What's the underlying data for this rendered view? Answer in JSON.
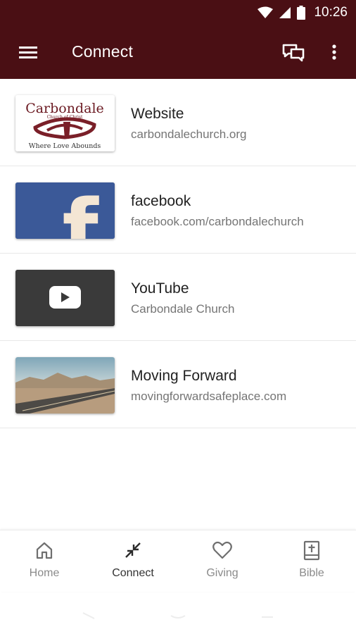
{
  "status_bar": {
    "time": "10:26"
  },
  "app_bar": {
    "title": "Connect"
  },
  "connect_items": [
    {
      "title": "Website",
      "subtitle": "carbondalechurch.org",
      "logo_text": "Carbondale",
      "logo_small": "Church of Christ",
      "logo_tagline": "Where Love Abounds"
    },
    {
      "title": "facebook",
      "subtitle": "facebook.com/carbondalechurch",
      "logo_letter": "f"
    },
    {
      "title": "YouTube",
      "subtitle": "Carbondale Church"
    },
    {
      "title": "Moving Forward",
      "subtitle": "movingforwardsafeplace.com"
    }
  ],
  "bottom_nav": [
    {
      "label": "Home",
      "icon": "home-icon"
    },
    {
      "label": "Connect",
      "icon": "connect-icon",
      "active": true
    },
    {
      "label": "Giving",
      "icon": "heart-icon"
    },
    {
      "label": "Bible",
      "icon": "bible-icon"
    }
  ],
  "colors": {
    "brand": "#4a0f14",
    "facebook": "#3b5998",
    "youtube_bg": "#3a3a3a"
  }
}
